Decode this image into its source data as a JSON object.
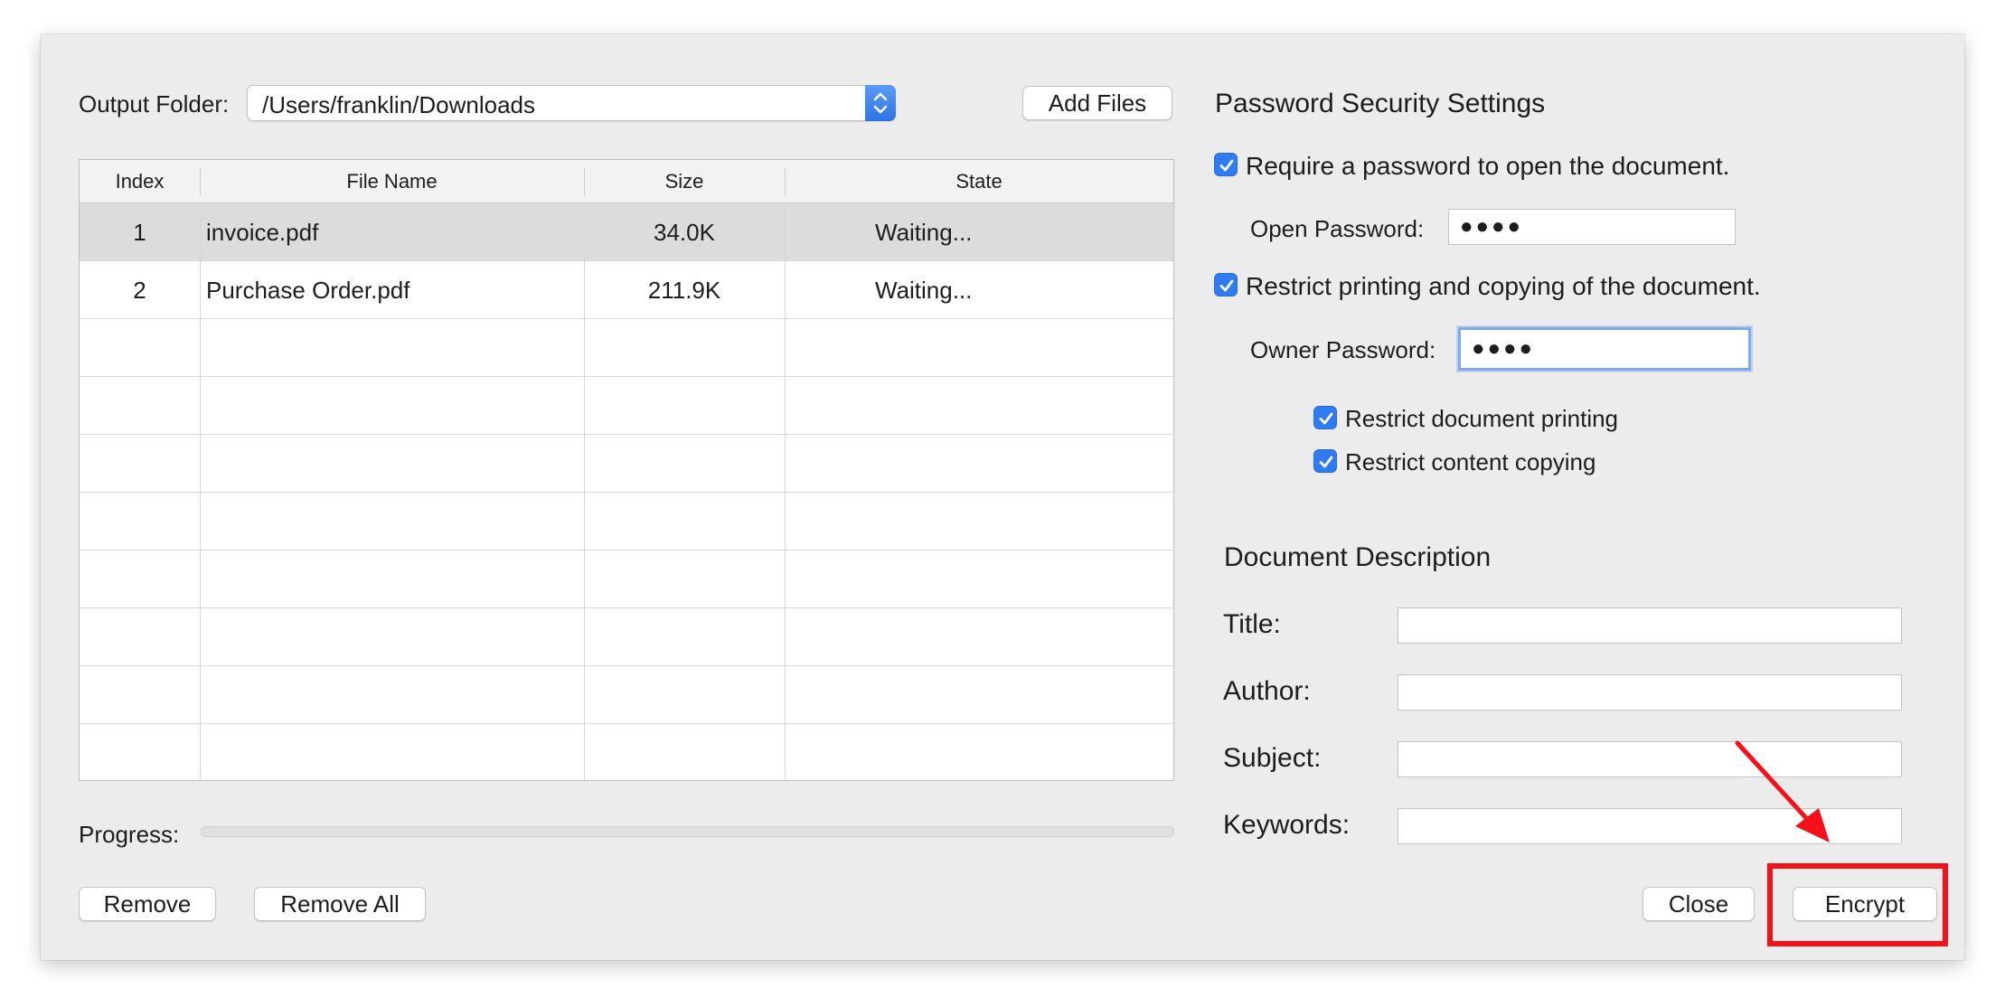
{
  "left": {
    "output_folder_label": "Output Folder:",
    "output_folder_value": "/Users/franklin/Downloads",
    "add_files_label": "Add Files",
    "table": {
      "columns": [
        "Index",
        "File Name",
        "Size",
        "State"
      ],
      "rows": [
        {
          "index": "1",
          "name": "invoice.pdf",
          "size": "34.0K",
          "state": "Waiting...",
          "selected": true
        },
        {
          "index": "2",
          "name": "Purchase Order.pdf",
          "size": "211.9K",
          "state": "Waiting...",
          "selected": false
        }
      ]
    },
    "progress_label": "Progress:",
    "progress_value": 0,
    "remove_label": "Remove",
    "remove_all_label": "Remove All"
  },
  "security": {
    "heading": "Password Security Settings",
    "require_open_label": "Require a password to open the document.",
    "require_open_checked": true,
    "open_password_label": "Open Password:",
    "open_password_value": "●●●●",
    "restrict_label": "Restrict printing and copying of the document.",
    "restrict_checked": true,
    "owner_password_label": "Owner Password:",
    "owner_password_value": "●●●●",
    "restrict_printing_label": "Restrict document printing",
    "restrict_printing_checked": true,
    "restrict_copying_label": "Restrict content copying",
    "restrict_copying_checked": true
  },
  "description": {
    "heading": "Document Description",
    "title_label": "Title:",
    "title_value": "",
    "author_label": "Author:",
    "author_value": "",
    "subject_label": "Subject:",
    "subject_value": "",
    "keywords_label": "Keywords:",
    "keywords_value": ""
  },
  "footer": {
    "close_label": "Close",
    "encrypt_label": "Encrypt"
  },
  "colors": {
    "accent": "#2f7bf5",
    "annotation": "#f5101a"
  }
}
